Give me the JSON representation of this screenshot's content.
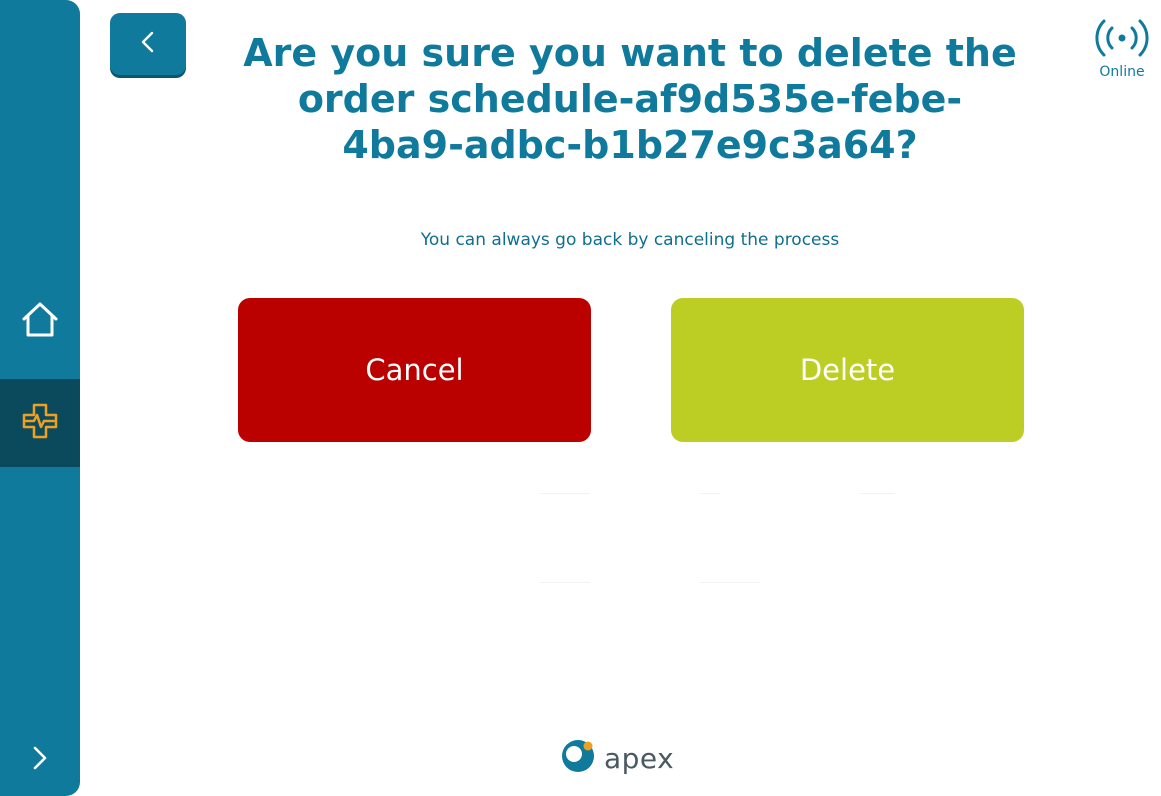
{
  "dialog": {
    "title": "Are you sure you want to delete the order schedule-af9d535e-febe-4ba9-adbc-b1b27e9c3a64?",
    "subtitle": "You can always go back by canceling the process",
    "cancel_label": "Cancel",
    "delete_label": "Delete"
  },
  "status": {
    "label": "Online",
    "icon": "broadcast-signal-icon"
  },
  "sidebar": {
    "items": [
      {
        "icon": "home-icon",
        "active": false
      },
      {
        "icon": "medical-cross-icon",
        "active": true
      }
    ],
    "expand_icon": "chevron-right-icon"
  },
  "header": {
    "back_icon": "chevron-left-icon"
  },
  "brand": {
    "name": "apex"
  },
  "colors": {
    "primary": "#0f7a9c",
    "sidebar_active": "#0a4a5c",
    "cancel": "#bb0000",
    "delete": "#bccd24",
    "accent_orange": "#f0a020"
  }
}
